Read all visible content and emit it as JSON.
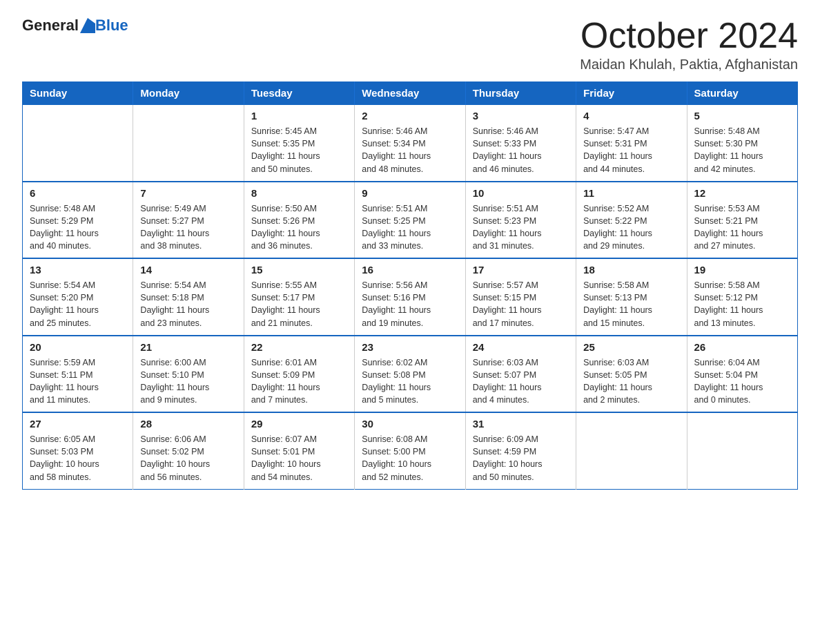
{
  "logo": {
    "text_general": "General",
    "text_blue": "Blue"
  },
  "title": {
    "month": "October 2024",
    "location": "Maidan Khulah, Paktia, Afghanistan"
  },
  "weekdays": [
    "Sunday",
    "Monday",
    "Tuesday",
    "Wednesday",
    "Thursday",
    "Friday",
    "Saturday"
  ],
  "weeks": [
    [
      {
        "day": "",
        "info": ""
      },
      {
        "day": "",
        "info": ""
      },
      {
        "day": "1",
        "info": "Sunrise: 5:45 AM\nSunset: 5:35 PM\nDaylight: 11 hours\nand 50 minutes."
      },
      {
        "day": "2",
        "info": "Sunrise: 5:46 AM\nSunset: 5:34 PM\nDaylight: 11 hours\nand 48 minutes."
      },
      {
        "day": "3",
        "info": "Sunrise: 5:46 AM\nSunset: 5:33 PM\nDaylight: 11 hours\nand 46 minutes."
      },
      {
        "day": "4",
        "info": "Sunrise: 5:47 AM\nSunset: 5:31 PM\nDaylight: 11 hours\nand 44 minutes."
      },
      {
        "day": "5",
        "info": "Sunrise: 5:48 AM\nSunset: 5:30 PM\nDaylight: 11 hours\nand 42 minutes."
      }
    ],
    [
      {
        "day": "6",
        "info": "Sunrise: 5:48 AM\nSunset: 5:29 PM\nDaylight: 11 hours\nand 40 minutes."
      },
      {
        "day": "7",
        "info": "Sunrise: 5:49 AM\nSunset: 5:27 PM\nDaylight: 11 hours\nand 38 minutes."
      },
      {
        "day": "8",
        "info": "Sunrise: 5:50 AM\nSunset: 5:26 PM\nDaylight: 11 hours\nand 36 minutes."
      },
      {
        "day": "9",
        "info": "Sunrise: 5:51 AM\nSunset: 5:25 PM\nDaylight: 11 hours\nand 33 minutes."
      },
      {
        "day": "10",
        "info": "Sunrise: 5:51 AM\nSunset: 5:23 PM\nDaylight: 11 hours\nand 31 minutes."
      },
      {
        "day": "11",
        "info": "Sunrise: 5:52 AM\nSunset: 5:22 PM\nDaylight: 11 hours\nand 29 minutes."
      },
      {
        "day": "12",
        "info": "Sunrise: 5:53 AM\nSunset: 5:21 PM\nDaylight: 11 hours\nand 27 minutes."
      }
    ],
    [
      {
        "day": "13",
        "info": "Sunrise: 5:54 AM\nSunset: 5:20 PM\nDaylight: 11 hours\nand 25 minutes."
      },
      {
        "day": "14",
        "info": "Sunrise: 5:54 AM\nSunset: 5:18 PM\nDaylight: 11 hours\nand 23 minutes."
      },
      {
        "day": "15",
        "info": "Sunrise: 5:55 AM\nSunset: 5:17 PM\nDaylight: 11 hours\nand 21 minutes."
      },
      {
        "day": "16",
        "info": "Sunrise: 5:56 AM\nSunset: 5:16 PM\nDaylight: 11 hours\nand 19 minutes."
      },
      {
        "day": "17",
        "info": "Sunrise: 5:57 AM\nSunset: 5:15 PM\nDaylight: 11 hours\nand 17 minutes."
      },
      {
        "day": "18",
        "info": "Sunrise: 5:58 AM\nSunset: 5:13 PM\nDaylight: 11 hours\nand 15 minutes."
      },
      {
        "day": "19",
        "info": "Sunrise: 5:58 AM\nSunset: 5:12 PM\nDaylight: 11 hours\nand 13 minutes."
      }
    ],
    [
      {
        "day": "20",
        "info": "Sunrise: 5:59 AM\nSunset: 5:11 PM\nDaylight: 11 hours\nand 11 minutes."
      },
      {
        "day": "21",
        "info": "Sunrise: 6:00 AM\nSunset: 5:10 PM\nDaylight: 11 hours\nand 9 minutes."
      },
      {
        "day": "22",
        "info": "Sunrise: 6:01 AM\nSunset: 5:09 PM\nDaylight: 11 hours\nand 7 minutes."
      },
      {
        "day": "23",
        "info": "Sunrise: 6:02 AM\nSunset: 5:08 PM\nDaylight: 11 hours\nand 5 minutes."
      },
      {
        "day": "24",
        "info": "Sunrise: 6:03 AM\nSunset: 5:07 PM\nDaylight: 11 hours\nand 4 minutes."
      },
      {
        "day": "25",
        "info": "Sunrise: 6:03 AM\nSunset: 5:05 PM\nDaylight: 11 hours\nand 2 minutes."
      },
      {
        "day": "26",
        "info": "Sunrise: 6:04 AM\nSunset: 5:04 PM\nDaylight: 11 hours\nand 0 minutes."
      }
    ],
    [
      {
        "day": "27",
        "info": "Sunrise: 6:05 AM\nSunset: 5:03 PM\nDaylight: 10 hours\nand 58 minutes."
      },
      {
        "day": "28",
        "info": "Sunrise: 6:06 AM\nSunset: 5:02 PM\nDaylight: 10 hours\nand 56 minutes."
      },
      {
        "day": "29",
        "info": "Sunrise: 6:07 AM\nSunset: 5:01 PM\nDaylight: 10 hours\nand 54 minutes."
      },
      {
        "day": "30",
        "info": "Sunrise: 6:08 AM\nSunset: 5:00 PM\nDaylight: 10 hours\nand 52 minutes."
      },
      {
        "day": "31",
        "info": "Sunrise: 6:09 AM\nSunset: 4:59 PM\nDaylight: 10 hours\nand 50 minutes."
      },
      {
        "day": "",
        "info": ""
      },
      {
        "day": "",
        "info": ""
      }
    ]
  ]
}
